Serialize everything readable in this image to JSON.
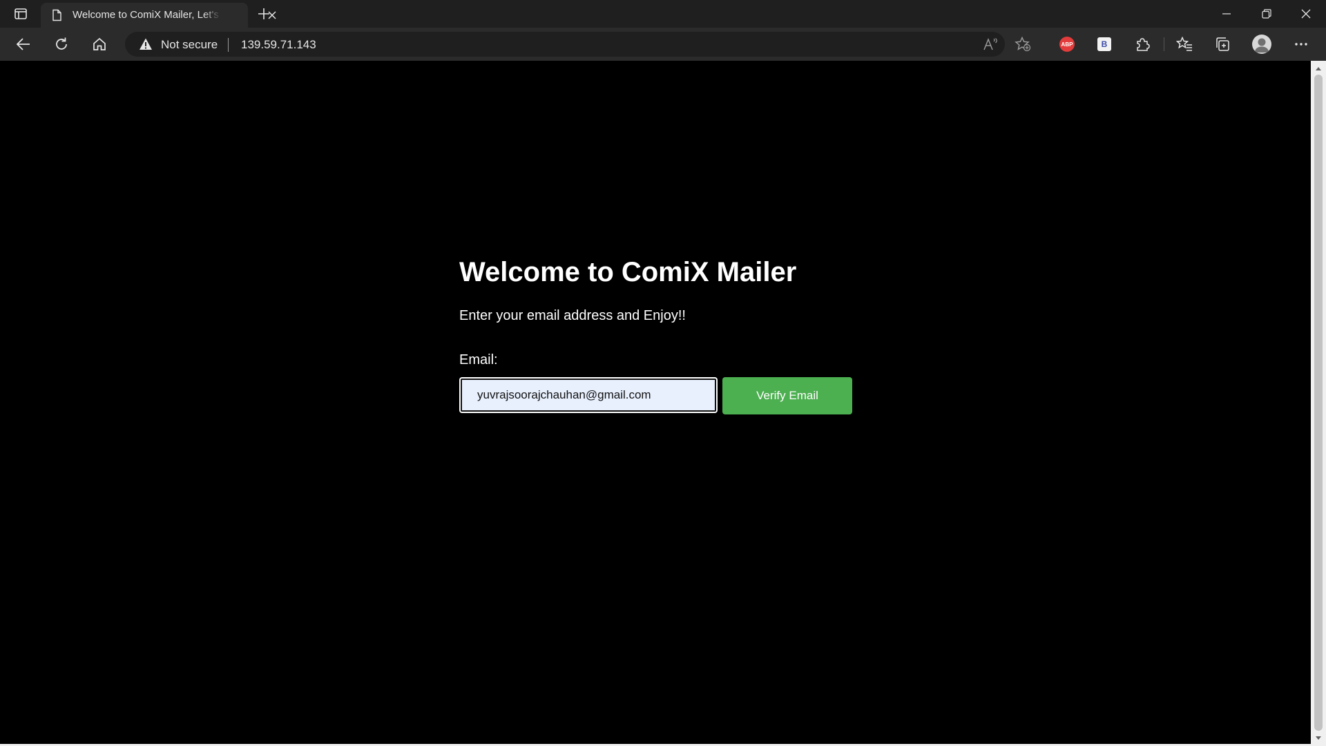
{
  "browser": {
    "tab": {
      "title": "Welcome to ComiX Mailer, Let's Get Started"
    },
    "address_bar": {
      "security_label": "Not secure",
      "url": "139.59.71.143"
    },
    "extensions": {
      "adblock_label": "ABP",
      "b_label": "B"
    }
  },
  "page": {
    "heading": "Welcome to ComiX Mailer",
    "subtitle": "Enter your email address and Enjoy!!",
    "email_label": "Email:",
    "email_value": "yuvrajsoorajchauhan@gmail.com",
    "verify_button": "Verify Email"
  },
  "colors": {
    "page_background": "#000000",
    "button": "#4caf50",
    "input_background": "#e8f0fe",
    "chrome_dark": "#1f1f1f",
    "chrome_toolbar": "#2b2b2b"
  }
}
